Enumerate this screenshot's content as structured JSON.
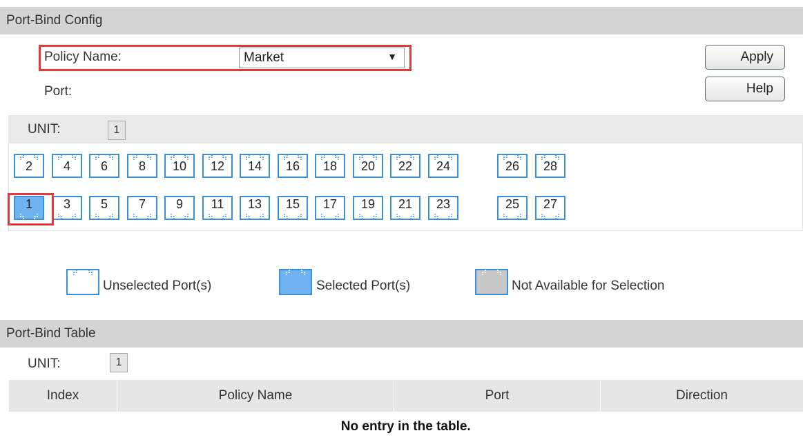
{
  "config": {
    "header": "Port-Bind Config",
    "policy_label": "Policy Name:",
    "policy_value": "Market",
    "port_label": "Port:",
    "apply_label": "Apply",
    "help_label": "Help",
    "unit_label": "UNIT:",
    "unit_value": "1"
  },
  "ports": {
    "top": [
      "2",
      "4",
      "6",
      "8",
      "10",
      "12",
      "14",
      "16",
      "18",
      "20",
      "22",
      "24",
      "26",
      "28"
    ],
    "bottom": [
      "1",
      "3",
      "5",
      "7",
      "9",
      "11",
      "13",
      "15",
      "17",
      "19",
      "21",
      "23",
      "25",
      "27"
    ],
    "selected": [
      "1"
    ]
  },
  "legend": {
    "unselected": "Unselected Port(s)",
    "selected": "Selected Port(s)",
    "not_available": "Not Available for Selection"
  },
  "table": {
    "header": "Port-Bind Table",
    "unit_label": "UNIT:",
    "unit_value": "1",
    "columns": [
      "Index",
      "Policy Name",
      "Port",
      "Direction"
    ],
    "empty_message": "No entry in the table."
  },
  "colors": {
    "header_bg": "#d4d4d4",
    "port_border": "#3b8fd6",
    "selected_fill": "#6fb4f0",
    "unavailable_fill": "#c8c8c8",
    "highlight_red": "#e03a3a"
  }
}
